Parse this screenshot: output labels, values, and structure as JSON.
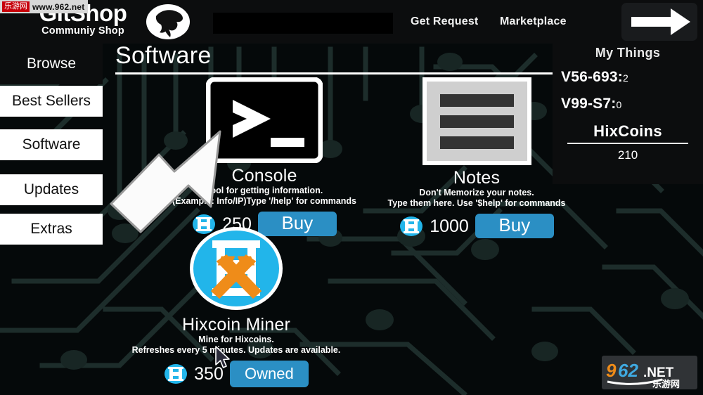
{
  "header": {
    "logo_title": "GitShop",
    "logo_subtitle": "Communiy Shop",
    "logo_icon": "bird-logo-icon",
    "search": {
      "value": "",
      "placeholder": ""
    },
    "nav": [
      {
        "id": "get-request",
        "label": "Get Request"
      },
      {
        "id": "marketplace",
        "label": "Marketplace"
      }
    ],
    "forward_button_icon": "arrow-right-icon"
  },
  "sidebar": {
    "items": [
      {
        "id": "browse",
        "label": "Browse",
        "state": "dark"
      },
      {
        "id": "best-sellers",
        "label": "Best Sellers",
        "state": "light"
      },
      {
        "id": "software",
        "label": "Software",
        "state": "light"
      },
      {
        "id": "updates",
        "label": "Updates",
        "state": "light"
      },
      {
        "id": "extras",
        "label": "Extras",
        "state": "light"
      }
    ]
  },
  "main": {
    "page_title": "Software"
  },
  "my_things": {
    "title": "My Things",
    "items": [
      {
        "name": "V56-693:",
        "count": "2"
      },
      {
        "name": "V99-S7:",
        "count": "0"
      }
    ],
    "currency_label": "HixCoins",
    "currency_value": "210"
  },
  "products": [
    {
      "id": "console",
      "icon": "terminal-icon",
      "name": "Console",
      "desc_line1": "Tool for getting information.",
      "desc_line2_pre": "(Example: Info/IP)Type '",
      "desc_line2_cmd": "/help",
      "desc_line2_post": "' for commands",
      "price": "250",
      "coin_icon": "hixcoin-icon",
      "action_label": "Buy",
      "action_state": "buy"
    },
    {
      "id": "notes",
      "icon": "notes-page-icon",
      "name": "Notes",
      "desc_line1": "Don't Memorize your notes.",
      "desc_line2_pre": "Type them here. Use '",
      "desc_line2_cmd": "$help",
      "desc_line2_post": "' for commands",
      "price": "1000",
      "coin_icon": "hixcoin-icon",
      "action_label": "Buy",
      "action_state": "buy"
    },
    {
      "id": "hixcoin-miner",
      "icon": "hixcoin-miner-icon",
      "name": "Hixcoin Miner",
      "desc_line1": "Mine for Hixcoins.",
      "desc_line2_pre": "Refreshes every 5 minutes. Updates are available.",
      "desc_line2_cmd": "",
      "desc_line2_post": "",
      "price": "350",
      "coin_icon": "hixcoin-icon",
      "action_label": "Owned",
      "action_state": "owned"
    }
  ],
  "overlays": {
    "hint_arrow_icon": "arrow-down-left-icon",
    "mouse_cursor_icon": "mouse-pointer-icon"
  },
  "watermarks": {
    "top_badge": "乐游网",
    "top_url": "www.962.net",
    "bottom_num": "962",
    "bottom_tld": ".NET",
    "bottom_cn": "乐游网"
  },
  "colors": {
    "accent_blue": "#2b8fc4",
    "coin_cyan": "#22b5ea",
    "miner_orange": "#ef8c19",
    "panel_dark": "#0c0d0e",
    "background": "#05090a",
    "circuit_line": "#1d2d2b"
  }
}
